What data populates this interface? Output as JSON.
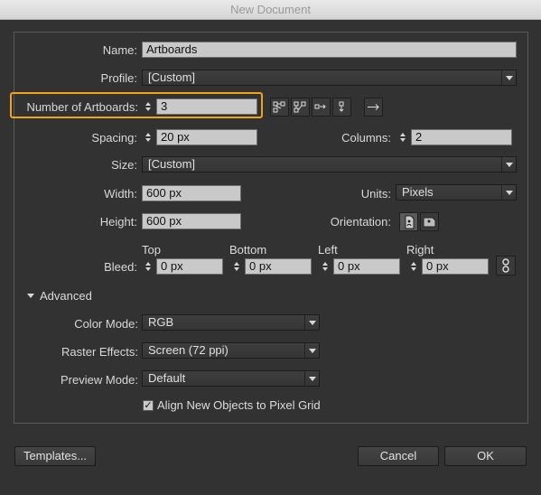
{
  "window": {
    "title": "New Document"
  },
  "name": {
    "label": "Name:",
    "value": "Artboards"
  },
  "profile": {
    "label": "Profile:",
    "value": "[Custom]"
  },
  "artboards": {
    "label": "Number of Artboards:",
    "value": "3",
    "arrange_icons": [
      "grid-by-row-icon",
      "grid-by-column-icon",
      "arrange-by-row-icon",
      "arrange-by-column-icon",
      "change-to-right-to-left-icon"
    ]
  },
  "spacing": {
    "label": "Spacing:",
    "value": "20 px"
  },
  "columns": {
    "label": "Columns:",
    "value": "2"
  },
  "size": {
    "label": "Size:",
    "value": "[Custom]"
  },
  "width": {
    "label": "Width:",
    "value": "600 px"
  },
  "units": {
    "label": "Units:",
    "value": "Pixels"
  },
  "height": {
    "label": "Height:",
    "value": "600 px"
  },
  "orientation": {
    "label": "Orientation:",
    "selected": "portrait"
  },
  "bleed": {
    "label": "Bleed:",
    "top": {
      "label": "Top",
      "value": "0 px"
    },
    "bottom": {
      "label": "Bottom",
      "value": "0 px"
    },
    "left": {
      "label": "Left",
      "value": "0 px"
    },
    "right": {
      "label": "Right",
      "value": "0 px"
    }
  },
  "advanced": {
    "label": "Advanced",
    "color_mode": {
      "label": "Color Mode:",
      "value": "RGB"
    },
    "raster_effects": {
      "label": "Raster Effects:",
      "value": "Screen (72 ppi)"
    },
    "preview_mode": {
      "label": "Preview Mode:",
      "value": "Default"
    },
    "align_pixel_grid": {
      "label": "Align New Objects to Pixel Grid",
      "checked": true
    }
  },
  "footer": {
    "templates_label": "Templates...",
    "cancel_label": "Cancel",
    "ok_label": "OK"
  },
  "colors": {
    "accent_highlight": "#f4a21a",
    "background": "#323232"
  }
}
